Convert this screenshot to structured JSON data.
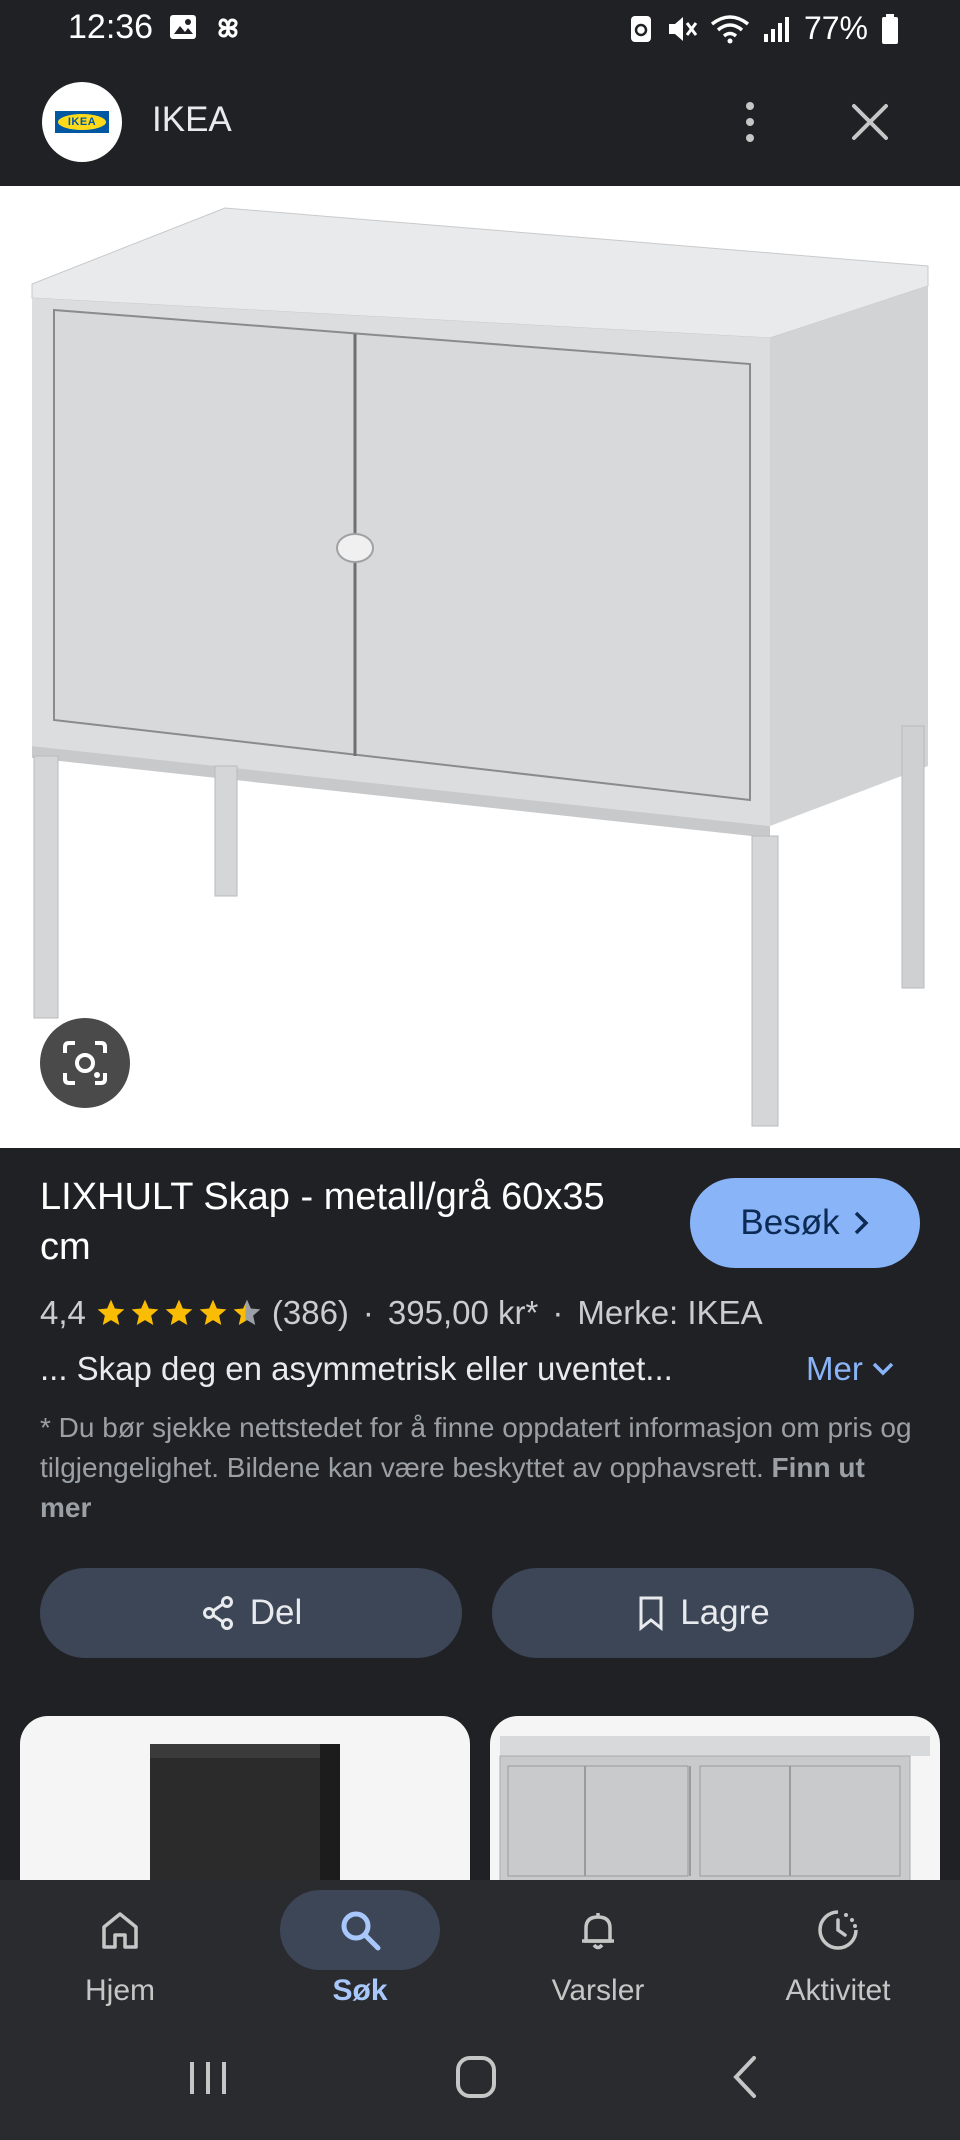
{
  "status_bar": {
    "time": "12:36",
    "battery": "77%"
  },
  "header": {
    "site_name": "IKEA",
    "logo_text": "IKEA"
  },
  "product": {
    "title": "LIXHULT Skap - metall/grå 60x35 cm",
    "visit_label": "Besøk",
    "rating": "4,4",
    "stars": 4.4,
    "review_count": "(386)",
    "price": "395,00 kr*",
    "brand": "Merke: IKEA",
    "snippet": "... Skap deg en asymmetrisk eller uventet...",
    "more_label": "Mer",
    "disclaimer": "* Du bør sjekke nettstedet for å finne oppdatert informasjon om pris og tilgjengelighet. Bildene kan være beskyttet av opphavsrett.",
    "learn_more": "Finn ut mer"
  },
  "actions": {
    "share_label": "Del",
    "save_label": "Lagre"
  },
  "bottom_nav": {
    "items": [
      {
        "label": "Hjem",
        "icon": "home-icon"
      },
      {
        "label": "Søk",
        "icon": "search-icon"
      },
      {
        "label": "Varsler",
        "icon": "bell-icon"
      },
      {
        "label": "Aktivitet",
        "icon": "activity-icon"
      }
    ],
    "active_index": 1
  },
  "colors": {
    "accent": "#8ab4f8",
    "background": "#202124",
    "star": "#fbbc04"
  }
}
